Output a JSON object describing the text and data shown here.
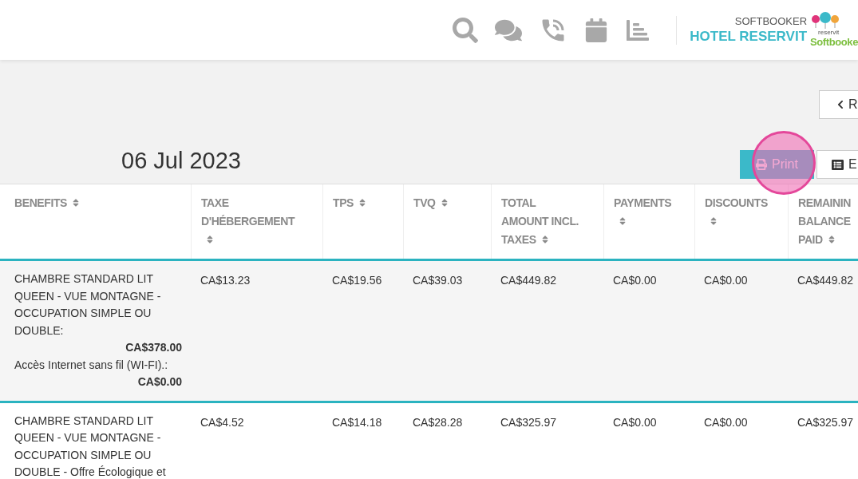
{
  "header": {
    "company": "SOFTBOOKER",
    "hotel": "HOTEL RESERVIT",
    "logo_small": "reservit",
    "logo_text": "Soft**booke**"
  },
  "toolbar": {
    "back_button": "R",
    "print_button": "Print",
    "export_button": "E"
  },
  "date": "06 Jul 2023",
  "table": {
    "columns": [
      "BENEFITS",
      "TAXE D'HÉBERGEMENT",
      "TPS",
      "TVQ",
      "TOTAL AMOUNT INCL. TAXES",
      "PAYMENTS",
      "DISCOUNTS",
      "REMAININ BALANCE PAID"
    ],
    "rows": [
      {
        "cells": [
          {
            "items": [
              {
                "label": "CHAMBRE STANDARD LIT QUEEN - VUE MONTAGNE - OCCUPATION SIMPLE OU DOUBLE:",
                "amount": "CA$378.00"
              },
              {
                "label": "Accès Internet sans fil (WI-FI).:",
                "amount": "CA$0.00"
              }
            ]
          },
          "CA$13.23",
          "CA$19.56",
          "CA$39.03",
          "CA$449.82",
          "CA$0.00",
          "CA$0.00",
          "CA$449.82"
        ]
      },
      {
        "cells": [
          {
            "items": [
              {
                "label": "CHAMBRE STANDARD LIT QUEEN - VUE MONTAGNE - OCCUPATION SIMPLE OU DOUBLE - Offre Écologique et"
              }
            ]
          },
          "CA$4.52",
          "CA$14.18",
          "CA$28.28",
          "CA$325.97",
          "CA$0.00",
          "CA$0.00",
          "CA$325.97"
        ]
      }
    ]
  }
}
